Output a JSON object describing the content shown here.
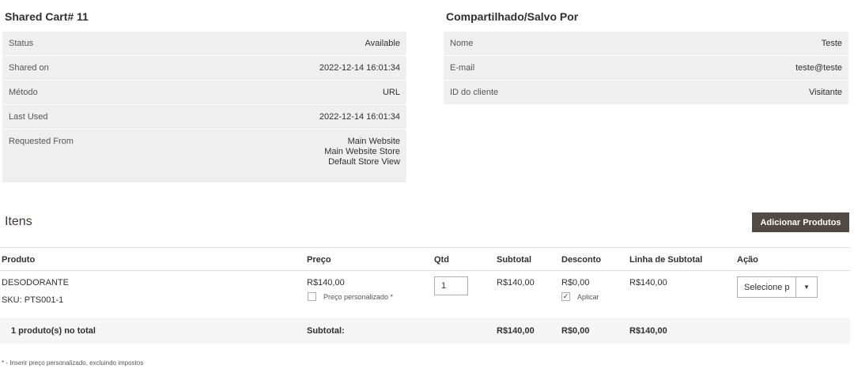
{
  "left_panel": {
    "title": "Shared Cart# 11",
    "rows": [
      {
        "label": "Status",
        "value": "Available"
      },
      {
        "label": "Shared on",
        "value": "2022-12-14 16:01:34"
      },
      {
        "label": "Método",
        "value": "URL"
      },
      {
        "label": "Last Used",
        "value": "2022-12-14 16:01:34"
      },
      {
        "label": "Requested From",
        "value_lines": [
          "Main Website",
          "Main Website Store",
          "Default Store View"
        ]
      }
    ]
  },
  "right_panel": {
    "title": "Compartilhado/Salvo Por",
    "rows": [
      {
        "label": "Nome",
        "value": "Teste"
      },
      {
        "label": "E-mail",
        "value": "teste@teste"
      },
      {
        "label": "ID do cliente",
        "value": "Visitante"
      }
    ]
  },
  "items": {
    "title": "Itens",
    "add_button": "Adicionar Produtos",
    "columns": [
      "Produto",
      "Preço",
      "Qtd",
      "Subtotal",
      "Desconto",
      "Linha de Subtotal",
      "Ação"
    ],
    "row": {
      "product_name": "DESODORANTE",
      "sku": "SKU: PTS001-1",
      "price": "R$140,00",
      "custom_price_label": "Preço personalizado *",
      "qty": "1",
      "subtotal": "R$140,00",
      "discount": "R$0,00",
      "apply_label": "Aplicar",
      "line_subtotal": "R$140,00",
      "action_select": "Selecione p"
    },
    "totals": {
      "count_label": "1 produto(s) no total",
      "subtotal_label": "Subtotal:",
      "subtotal": "R$140,00",
      "discount": "R$0,00",
      "line_subtotal": "R$140,00"
    },
    "footnote": "* - Inserir preço personalizado, excluindo impostos"
  }
}
